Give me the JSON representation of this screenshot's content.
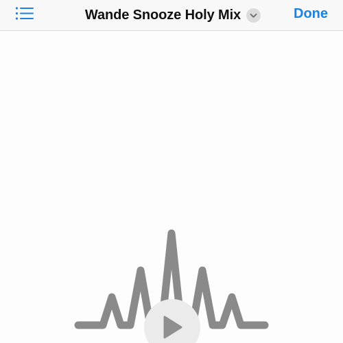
{
  "navbar": {
    "title": "Wande Snooze Holy Mix",
    "done_label": "Done"
  },
  "icons": {
    "list": "list-icon",
    "chevron": "chevron-down-icon",
    "play": "play-icon",
    "waveform": "waveform-icon"
  },
  "colors": {
    "accent": "#1a82e2",
    "waveform": "#8a8a8a",
    "play_button_bg": "#ebebeb",
    "play_glyph": "#8f8f8f"
  }
}
